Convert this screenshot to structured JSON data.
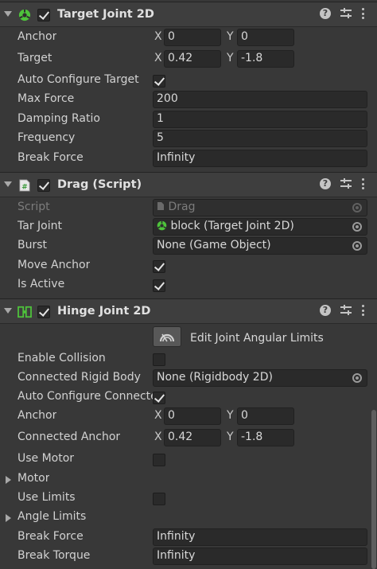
{
  "target_joint": {
    "title": "Target Joint 2D",
    "anchor_label": "Anchor",
    "anchor_x": "0",
    "anchor_y": "0",
    "target_label": "Target",
    "target_x": "0.42",
    "target_y": "-1.8",
    "auto_configure_label": "Auto Configure Target",
    "max_force_label": "Max Force",
    "max_force": "200",
    "damping_label": "Damping Ratio",
    "damping": "1",
    "frequency_label": "Frequency",
    "frequency": "5",
    "break_force_label": "Break Force",
    "break_force": "Infinity"
  },
  "drag_script": {
    "title": "Drag (Script)",
    "script_label": "Script",
    "script_value": "Drag",
    "tar_joint_label": "Tar Joint",
    "tar_joint_value": "block (Target Joint 2D)",
    "burst_label": "Burst",
    "burst_value": "None (Game Object)",
    "move_anchor_label": "Move Anchor",
    "is_active_label": "Is Active"
  },
  "hinge_joint": {
    "title": "Hinge Joint 2D",
    "edit_limits_label": "Edit Joint Angular Limits",
    "enable_collision_label": "Enable Collision",
    "connected_body_label": "Connected Rigid Body",
    "connected_body_value": "None (Rigidbody 2D)",
    "auto_configure_label": "Auto Configure Connecte",
    "anchor_label": "Anchor",
    "anchor_x": "0",
    "anchor_y": "0",
    "connected_anchor_label": "Connected Anchor",
    "connected_anchor_x": "0.42",
    "connected_anchor_y": "-1.8",
    "use_motor_label": "Use Motor",
    "motor_label": "Motor",
    "use_limits_label": "Use Limits",
    "angle_limits_label": "Angle Limits",
    "break_force_label": "Break Force",
    "break_force": "Infinity",
    "break_torque_label": "Break Torque",
    "break_torque": "Infinity"
  },
  "axis_labels": {
    "x": "X",
    "y": "Y"
  },
  "header_icons": {
    "help": "?",
    "settings": "preset-icon",
    "menu": "menu-icon"
  },
  "colors": {
    "background": "#383838",
    "field": "#2a2a2a",
    "header": "#3e3e3e",
    "joint_icon": "#4ec33b",
    "script_icon": "#3b9a3b"
  }
}
